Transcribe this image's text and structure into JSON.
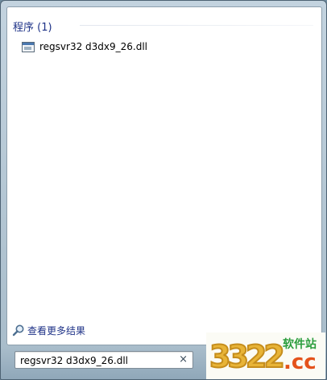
{
  "results_group": {
    "header": "程序 (1)",
    "items": [
      {
        "label": "regsvr32 d3dx9_26.dll",
        "icon": "application-window-icon"
      }
    ]
  },
  "see_more": {
    "label": "查看更多结果",
    "icon": "magnifier-icon"
  },
  "search": {
    "value": "regsvr32 d3dx9_26.dll",
    "clear_symbol": "×"
  },
  "watermark": {
    "digits": "3322",
    "site": "软件站",
    "tld": ".cc"
  },
  "colors": {
    "accent_text": "#1e3287",
    "panel": "#ffffff",
    "frame": "#a9bdcb"
  }
}
